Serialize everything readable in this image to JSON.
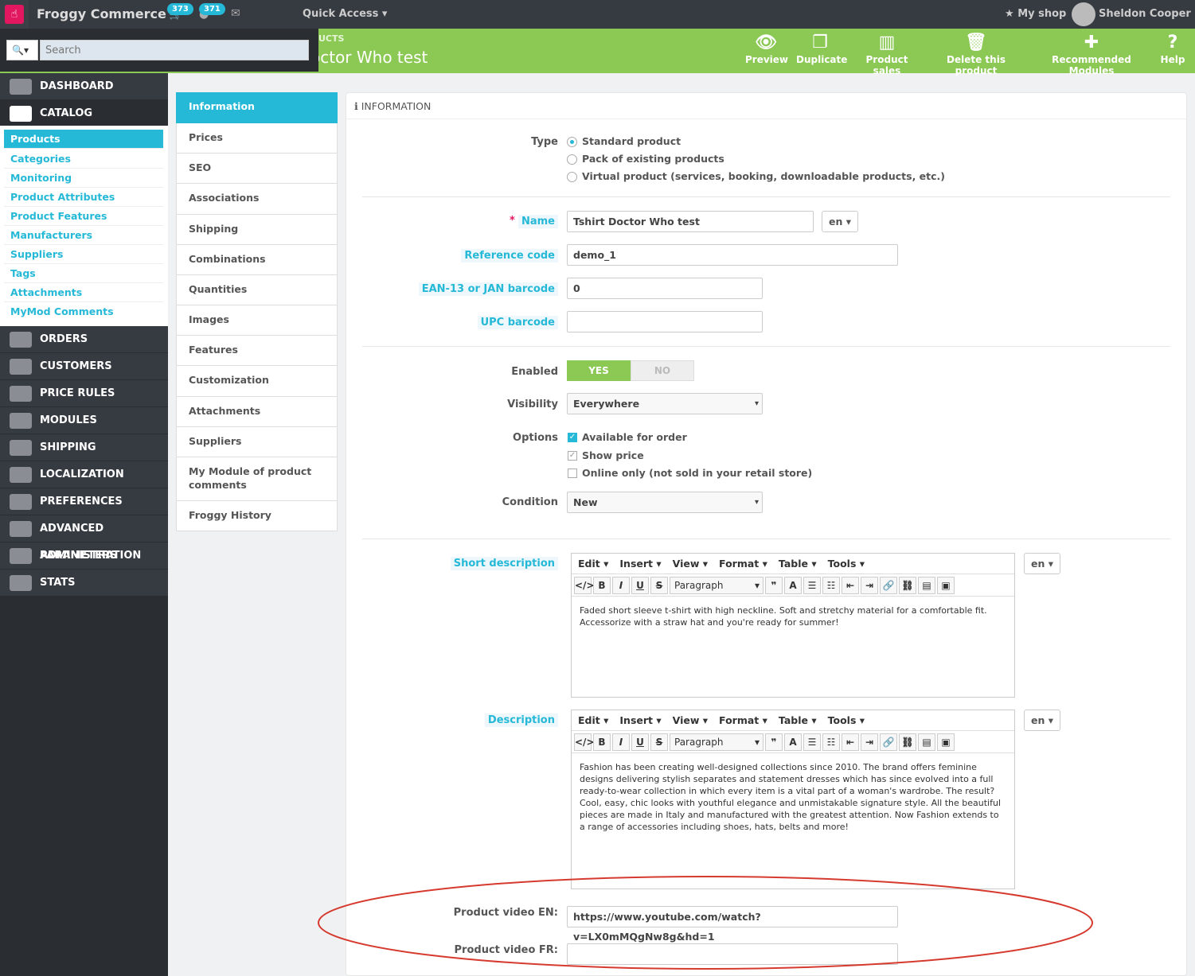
{
  "topbar": {
    "shop_name": "Froggy Commerce",
    "orders_badge": "373",
    "customers_badge": "371",
    "quick_access": "Quick Access",
    "my_shop": "My shop",
    "user": "Sheldon Cooper"
  },
  "search": {
    "placeholder": "Search"
  },
  "header": {
    "breadcrumb": "UCTS",
    "title": "octor Who test",
    "buttons": [
      {
        "label": "Preview",
        "icon": "eye-icon"
      },
      {
        "label": "Duplicate",
        "icon": "copy-icon"
      },
      {
        "label": "Product sales",
        "icon": "bar-chart-icon"
      },
      {
        "label": "Delete this product",
        "icon": "trash-icon"
      },
      {
        "label": "Recommended Modules",
        "icon": "puzzle-icon"
      },
      {
        "label": "Help",
        "icon": "help-icon"
      }
    ]
  },
  "sidebar": {
    "dashboard": "DASHBOARD",
    "catalog": "CATALOG",
    "catalog_items": [
      "Products",
      "Categories",
      "Monitoring",
      "Product Attributes",
      "Product Features",
      "Manufacturers",
      "Suppliers",
      "Tags",
      "Attachments",
      "MyMod Comments"
    ],
    "sections": [
      "ORDERS",
      "CUSTOMERS",
      "PRICE RULES",
      "MODULES",
      "SHIPPING",
      "LOCALIZATION",
      "PREFERENCES",
      "ADVANCED PARAMETERS",
      "ADMINISTRATION",
      "STATS"
    ]
  },
  "tabs": [
    "Information",
    "Prices",
    "SEO",
    "Associations",
    "Shipping",
    "Combinations",
    "Quantities",
    "Images",
    "Features",
    "Customization",
    "Attachments",
    "Suppliers",
    "My Module of product comments",
    "Froggy History"
  ],
  "form": {
    "panel_title": "INFORMATION",
    "type_label": "Type",
    "type_options": [
      "Standard product",
      "Pack of existing products",
      "Virtual product (services, booking, downloadable products, etc.)"
    ],
    "name_label": "Name",
    "required_mark": "*",
    "name_value": "Tshirt Doctor Who test",
    "lang": "en",
    "reference_label": "Reference code",
    "reference_value": "demo_1",
    "ean_label": "EAN-13 or JAN barcode",
    "ean_value": "0",
    "upc_label": "UPC barcode",
    "upc_value": "",
    "enabled_label": "Enabled",
    "yes": "YES",
    "no": "NO",
    "visibility_label": "Visibility",
    "visibility_value": "Everywhere",
    "options_label": "Options",
    "options": [
      "Available for order",
      "Show price",
      "Online only (not sold in your retail store)"
    ],
    "condition_label": "Condition",
    "condition_value": "New",
    "short_desc_label": "Short description",
    "desc_label": "Description",
    "editor_menu": [
      "Edit",
      "Insert",
      "View",
      "Format",
      "Table",
      "Tools"
    ],
    "editor_format": "Paragraph",
    "short_desc_text": "Faded short sleeve t-shirt with high neckline. Soft and stretchy material for a comfortable fit. Accessorize with a straw hat and you're ready for summer!",
    "desc_text": "Fashion has been creating well-designed collections since 2010. The brand offers feminine designs delivering stylish separates and statement dresses which has since evolved into a full ready-to-wear collection in which every item is a vital part of a woman's wardrobe. The result? Cool, easy, chic looks with youthful elegance and unmistakable signature style. All the beautiful pieces are made in Italy and manufactured with the greatest attention. Now Fashion extends to a range of accessories including shoes, hats, belts and more!",
    "video_en_label": "Product video EN:",
    "video_en_value": "https://www.youtube.com/watch?v=LX0mMQgNw8g&hd=1",
    "video_fr_label": "Product video FR:",
    "video_fr_value": ""
  },
  "colors": {
    "accent": "#25b9d7",
    "header": "#8bc954",
    "sidebar": "#363a41",
    "annotation": "#d63a2f"
  }
}
